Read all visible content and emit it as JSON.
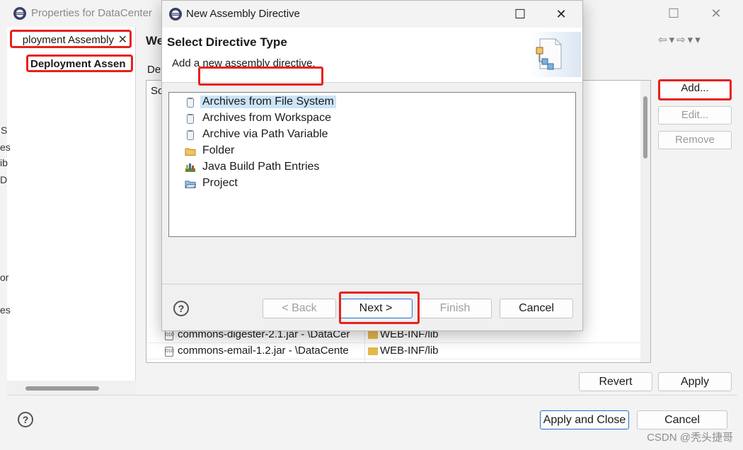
{
  "background_window": {
    "title": "Properties for DataCenter",
    "filter_value": "ployment Assembly",
    "tree_selected": "Deployment Assen",
    "page_title": "We",
    "page_desc": "De",
    "table_col_head": "So",
    "add_label": "Add...",
    "edit_label": "Edit...",
    "remove_label": "Remove",
    "rows": [
      {
        "source": "commons-digester-2.1.jar - \\DataCer",
        "deploy": "WEB-INF/lib"
      },
      {
        "source": "commons-email-1.2.jar - \\DataCente",
        "deploy": "WEB-INF/lib"
      }
    ],
    "revert_label": "Revert",
    "apply_label": "Apply",
    "apply_close_label": "Apply and Close",
    "cancel_label": "Cancel",
    "edge_letters": [
      "S",
      "es",
      "ib",
      "D",
      "or",
      "es"
    ]
  },
  "dialog": {
    "title": "New Assembly Directive",
    "header_title": "Select Directive Type",
    "header_subtitle": "Add a new assembly directive.",
    "items": [
      {
        "label": "Archives from File System",
        "icon": "jar-icon",
        "selected": true
      },
      {
        "label": "Archives from Workspace",
        "icon": "jar-icon"
      },
      {
        "label": "Archive via Path Variable",
        "icon": "jar-icon"
      },
      {
        "label": "Folder",
        "icon": "folder-icon"
      },
      {
        "label": "Java Build Path Entries",
        "icon": "library-icon"
      },
      {
        "label": "Project",
        "icon": "project-folder-icon"
      }
    ],
    "back_label": "< Back",
    "next_label": "Next >",
    "finish_label": "Finish",
    "cancel_label": "Cancel"
  },
  "watermark": "CSDN @秃头捷哥",
  "colors": {
    "highlight_red": "#e8201c",
    "selection_blue": "#cce4f7",
    "primary_border": "#1e70cf"
  }
}
